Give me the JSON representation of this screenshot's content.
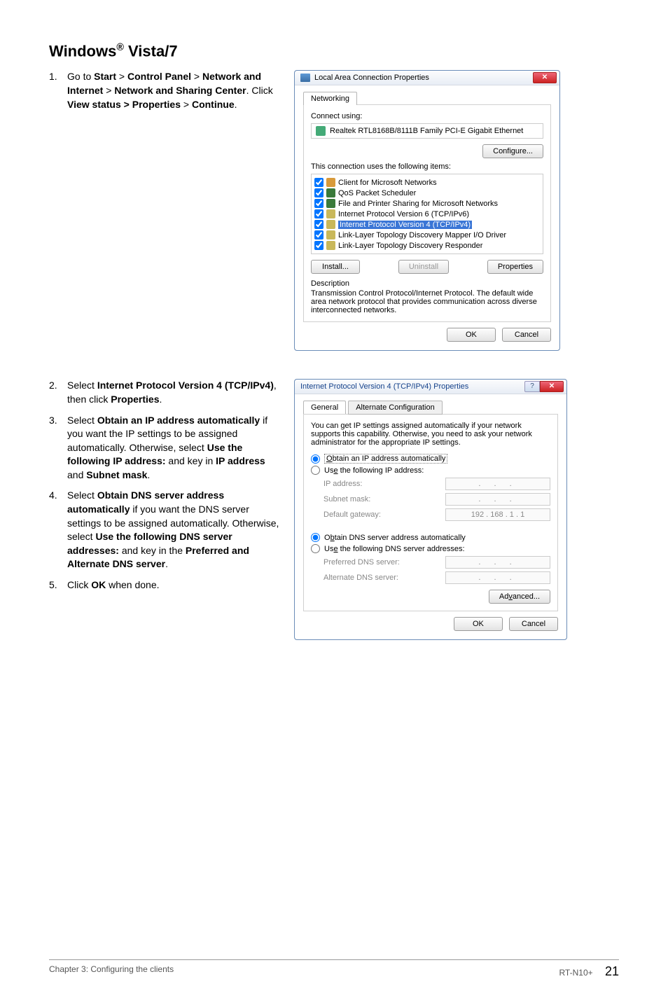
{
  "heading": {
    "pre": "Windows",
    "reg": "®",
    "post": " Vista/7"
  },
  "steps1": [
    {
      "n": "1.",
      "html": "Go to <b>Start</b> > <b>Control Panel</b> > <b>Network and Internet</b> > <b>Network and Sharing Center</b>. Click <b>View status > Properties</b> > <b>Continue</b>."
    }
  ],
  "steps2": [
    {
      "n": "2.",
      "html": "Select <b>Internet Protocol Version 4 (TCP/IPv4)</b>, then click <b>Properties</b>."
    },
    {
      "n": "3.",
      "html": "Select <b>Obtain an IP address automatically</b> if you want the IP settings to be assigned automatically. Otherwise, select <b>Use the following IP address:</b> and key in <b>IP address</b> and <b>Subnet mask</b>."
    },
    {
      "n": "4.",
      "html": "Select <b>Obtain DNS server address automatically</b> if you want the DNS server settings to be assigned automatically. Otherwise, select <b>Use the following DNS server addresses:</b> and key in the <b>Preferred and Alternate DNS server</b>."
    },
    {
      "n": "5.",
      "html": "Click <b>OK</b> when done."
    }
  ],
  "dialog1": {
    "title": "Local Area Connection Properties",
    "tab": "Networking",
    "connect_label": "Connect using:",
    "adapter": "Realtek RTL8168B/8111B Family PCI-E Gigabit Ethernet",
    "configure": "Configure...",
    "uses_label": "This connection uses the following items:",
    "items": [
      {
        "icon": "ic-client",
        "label": "Client for Microsoft Networks",
        "sel": false
      },
      {
        "icon": "ic-qos",
        "label": "QoS Packet Scheduler",
        "sel": false
      },
      {
        "icon": "ic-file",
        "label": "File and Printer Sharing for Microsoft Networks",
        "sel": false
      },
      {
        "icon": "ic-proto",
        "label": "Internet Protocol Version 6 (TCP/IPv6)",
        "sel": false
      },
      {
        "icon": "ic-proto",
        "label": "Internet Protocol Version 4 (TCP/IPv4)",
        "sel": true
      },
      {
        "icon": "ic-proto",
        "label": "Link-Layer Topology Discovery Mapper I/O Driver",
        "sel": false
      },
      {
        "icon": "ic-proto",
        "label": "Link-Layer Topology Discovery Responder",
        "sel": false
      }
    ],
    "install": "Install...",
    "uninstall": "Uninstall",
    "properties": "Properties",
    "desc_label": "Description",
    "desc": "Transmission Control Protocol/Internet Protocol. The default wide area network protocol that provides communication across diverse interconnected networks.",
    "ok": "OK",
    "cancel": "Cancel"
  },
  "dialog2": {
    "title": "Internet Protocol Version 4 (TCP/IPv4) Properties",
    "tab1": "General",
    "tab2": "Alternate Configuration",
    "intro": "You can get IP settings assigned automatically if your network supports this capability. Otherwise, you need to ask your network administrator for the appropriate IP settings.",
    "r1": "Obtain an IP address automatically",
    "r2": "Use the following IP address:",
    "ip": "IP address:",
    "subnet": "Subnet mask:",
    "gw": "Default gateway:",
    "gw_val": "192 . 168 .  1  .  1",
    "r3": "Obtain DNS server address automatically",
    "r4": "Use the following DNS server addresses:",
    "pdns": "Preferred DNS server:",
    "adns": "Alternate DNS server:",
    "advanced": "Advanced...",
    "ok": "OK",
    "cancel": "Cancel"
  },
  "footer": {
    "left": "Chapter 3: Configuring the clients",
    "model": "RT-N10+",
    "page": "21"
  }
}
